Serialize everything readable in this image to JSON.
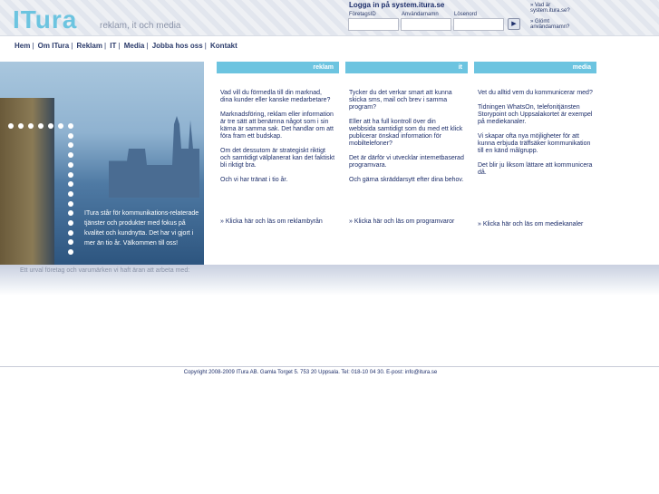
{
  "header": {
    "logo": "ITura",
    "tagline": "reklam, it och media",
    "login": {
      "title": "Logga in på system.itura.se",
      "company_label": "FöretagsID",
      "user_label": "Användarnamn",
      "password_label": "Lösenord",
      "submit": "▶"
    },
    "links": [
      "» Vad är system.itura.se?",
      "» Glömt användarnamn?"
    ]
  },
  "nav": [
    "Hem",
    "Om ITura",
    "Reklam",
    "IT",
    "Media",
    "Jobba hos oss",
    "Kontakt"
  ],
  "photo_text": "ITura står för kommunikations-relaterade tjänster och produkter med fokus på kvalitet och kundnytta. Det har vi gjort i mer än tio år. Välkommen till oss!",
  "band_text": "Ett urval företag och varumärken vi haft äran att arbeta med:",
  "columns": [
    {
      "title": "reklam",
      "paragraphs": [
        "Vad vill du förmedla till din marknad, dina kunder eller kanske medarbetare?",
        "Marknadsföring, reklam eller information är tre sätt att benämna något som i sin kärna är samma sak. Det handlar om att föra fram ett budskap.",
        "Om det dessutom är strategiskt riktigt och samtidigt välplanerat kan det faktiskt bli riktigt bra.",
        "Och vi har tränat i tio år."
      ],
      "link": "» Klicka här och läs om reklambyrån"
    },
    {
      "title": "it",
      "paragraphs": [
        "Tycker du det verkar smart att kunna skicka sms, mail och brev i samma program?",
        "Eller att ha full kontroll över din webbsida samtidigt som du med ett klick publicerar önskad information för mobiltelefoner?",
        "Det är därför vi utvecklar internetbaserad programvara.",
        "Och gärna skräddarsytt efter dina behov."
      ],
      "link": "» Klicka här och läs om programvaror"
    },
    {
      "title": "media",
      "paragraphs": [
        "Vet du alltid vem du kommunicerar med?",
        "Tidningen WhatsOn, telefonitjänsten Storypoint och Uppsalakortet är exempel på mediekanaler.",
        "Vi skapar ofta nya möjligheter för att kunna erbjuda träffsäker kommunikation till en känd målgrupp.",
        "Det blir ju liksom lättare att kommunicera då."
      ],
      "link": "» Klicka här och läs om mediekanaler"
    }
  ],
  "footer": "Copyright 2008-2009 ITura AB. Gamla Torget 5. 753 20 Uppsala. Tel: 018-10 04 30. E-post: info@itura.se"
}
